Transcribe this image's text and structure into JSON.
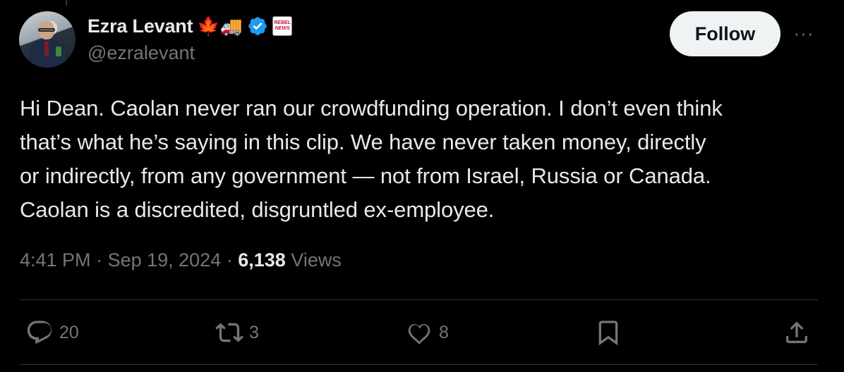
{
  "author": {
    "name": "Ezra Levant",
    "emoji": "🍁🚚",
    "handle": "@ezralevant",
    "badge_text": "REBEL NEWS"
  },
  "follow_label": "Follow",
  "more_label": "···",
  "tweet_lines": [
    "Hi Dean. Caolan never ran our crowdfunding operation. I don’t even think",
    "that’s what he’s saying in this clip. We have never taken money, directly",
    "or indirectly, from any government — not from Israel, Russia or Canada.",
    "Caolan is a discredited, disgruntled ex-employee."
  ],
  "meta": {
    "time": "4:41 PM",
    "sep1": " · ",
    "date": "Sep 19, 2024",
    "sep2": " · ",
    "views_count": "6,138",
    "views_label": " Views"
  },
  "actions": {
    "replies": "20",
    "reposts": "3",
    "likes": "8"
  },
  "colors": {
    "background": "#000000",
    "text": "#e7e9ea",
    "muted": "#71767b",
    "verified": "#1d9bf0",
    "follow_bg": "#eff3f4"
  }
}
